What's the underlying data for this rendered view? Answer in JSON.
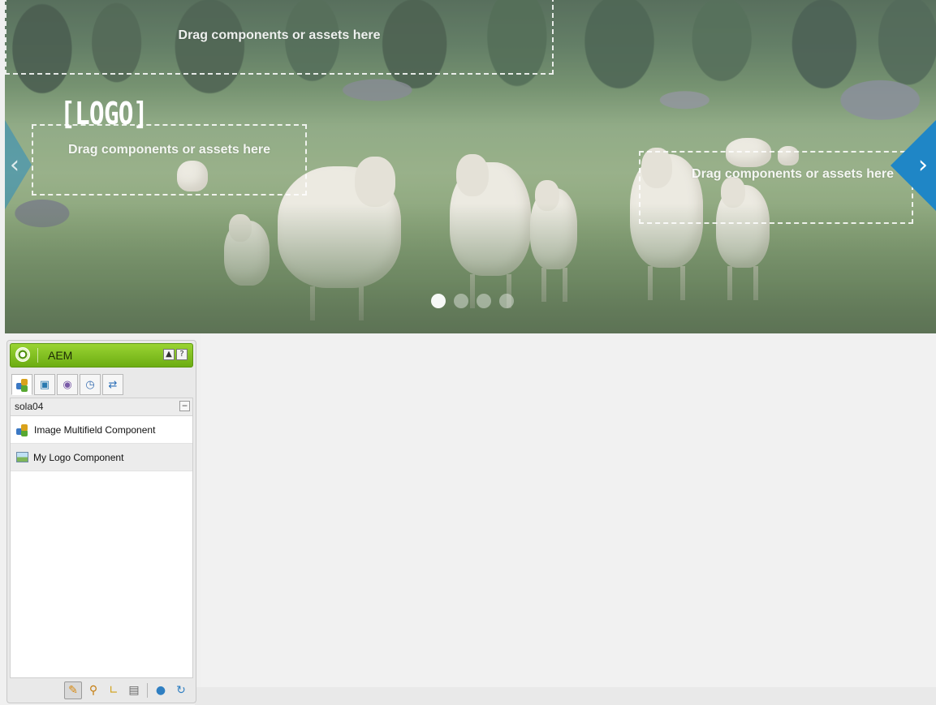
{
  "hero": {
    "drop_zone_top": "Drag components or assets here",
    "drop_zone_left": "Drag components or assets here",
    "drop_zone_right": "Drag components or assets here",
    "logo_text": "[LOGO]",
    "prev_icon": "chevron-left-icon",
    "next_icon": "chevron-right-icon",
    "slides": 4,
    "active_slide": 1
  },
  "sidekick": {
    "title": "AEM",
    "collapse_label": "▲",
    "help_label": "?",
    "tabs": [
      "components-icon",
      "page-icon",
      "versioning-icon",
      "workflow-icon",
      "info-icon"
    ],
    "group_name": "sola04",
    "collapse_group_label": "−",
    "components": [
      {
        "label": "Image Multifield Component",
        "icon": "component-icon"
      },
      {
        "label": "My Logo Component",
        "icon": "image-icon"
      }
    ],
    "footer_tools": [
      "edit-pencil-icon",
      "preview-magnifier-icon",
      "design-ruler-icon",
      "scaffolding-icon",
      "globe-icon",
      "refresh-icon"
    ]
  },
  "colors": {
    "sidekick_header": "#7dbb1c",
    "carousel_arrow": "#1f86c6"
  }
}
